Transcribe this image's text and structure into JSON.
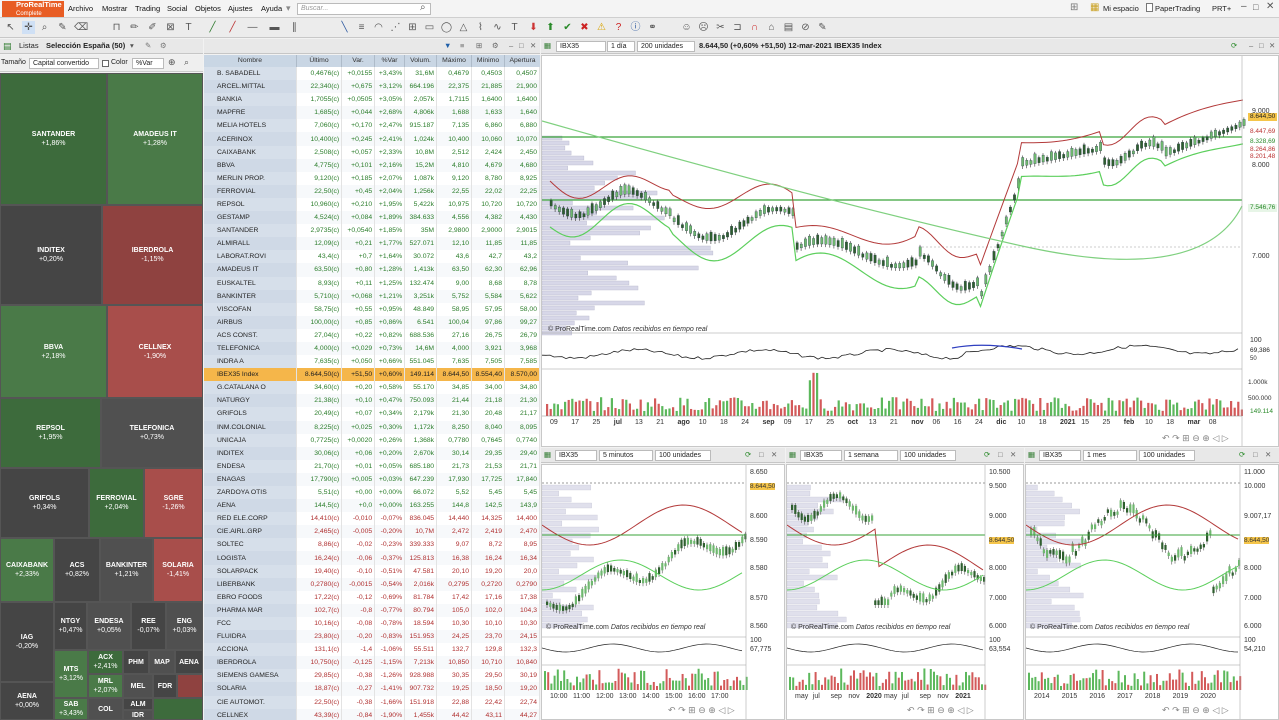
{
  "app": {
    "logo_line1": "ProRealTime",
    "logo_line2": "Complete"
  },
  "menu": [
    "Archivo",
    "Mostrar",
    "Trading",
    "Social",
    "Objetos",
    "Ajustes",
    "Ayuda"
  ],
  "search_placeholder": "Buscar...",
  "topright": {
    "space": "Mi espacio",
    "paper": "PaperTrading",
    "prt": "PRT+"
  },
  "lists": {
    "label": "Listas",
    "selection": "Selección España (50)",
    "size_label": "Tamaño",
    "size_value": "Capital convertido",
    "color_label": "Color",
    "color_value": "%Var"
  },
  "heatmap": [
    {
      "name": "SANTANDER",
      "pct": "+1,86%"
    },
    {
      "name": "AMADEUS IT",
      "pct": "+1,28%"
    },
    {
      "name": "INDITEX",
      "pct": "+0,20%"
    },
    {
      "name": "IBERDROLA",
      "pct": "-1,15%"
    },
    {
      "name": "BBVA",
      "pct": "+2,18%"
    },
    {
      "name": "CELLNEX",
      "pct": "-1,90%"
    },
    {
      "name": "REPSOL",
      "pct": "+1,95%"
    },
    {
      "name": "TELEFONICA",
      "pct": "+0,73%"
    },
    {
      "name": "GRIFOLS",
      "pct": "+0,34%"
    },
    {
      "name": "FERROVIAL",
      "pct": "+2,04%"
    },
    {
      "name": "SGRE",
      "pct": "-1,26%"
    },
    {
      "name": "CAIXABANK",
      "pct": "+2,33%"
    },
    {
      "name": "ACS",
      "pct": "+0,82%"
    },
    {
      "name": "BANKINTER",
      "pct": "+1,21%"
    },
    {
      "name": "SOLARIA",
      "pct": "-1,41%"
    },
    {
      "name": "NTGY",
      "pct": "+0,47%"
    },
    {
      "name": "ENDESA",
      "pct": "+0,05%"
    },
    {
      "name": "REE",
      "pct": "-0,07%"
    },
    {
      "name": "ENG",
      "pct": "+0,03%"
    },
    {
      "name": "IAG",
      "pct": "-0,20%"
    },
    {
      "name": "MTS",
      "pct": "+3,12%"
    },
    {
      "name": "ACX",
      "pct": "+2,41%"
    },
    {
      "name": "PHM",
      "pct": ""
    },
    {
      "name": "MAP",
      "pct": ""
    },
    {
      "name": "AENA",
      "pct": ""
    },
    {
      "name": "MRL",
      "pct": "+2,07%"
    },
    {
      "name": "MEL",
      "pct": ""
    },
    {
      "name": "FDR",
      "pct": ""
    },
    {
      "name": "AENA",
      "pct": "+0,00%"
    },
    {
      "name": "SAB",
      "pct": "+3,43%"
    },
    {
      "name": "COL",
      "pct": ""
    },
    {
      "name": "ALM",
      "pct": ""
    },
    {
      "name": "IDR",
      "pct": ""
    }
  ],
  "watchlist": {
    "columns": [
      "Nombre",
      "Último",
      "Var.",
      "%Var",
      "Volum.",
      "Máximo",
      "Mínimo",
      "Apertura"
    ],
    "rows": [
      [
        "B. SABADELL",
        "0,4676(c)",
        "+0,0155",
        "+3,43%",
        "31,6M",
        "0,4679",
        "0,4503",
        "0,4507"
      ],
      [
        "ARCEL.MITTAL",
        "22,340(c)",
        "+0,675",
        "+3,12%",
        "664.196",
        "22,375",
        "21,885",
        "21,900"
      ],
      [
        "BANKIA",
        "1,7055(c)",
        "+0,0505",
        "+3,05%",
        "2,057k",
        "1,7115",
        "1,6400",
        "1,6400"
      ],
      [
        "MAPFRE",
        "1,685(c)",
        "+0,044",
        "+2,68%",
        "4,806k",
        "1,688",
        "1,633",
        "1,640"
      ],
      [
        "MELIA HOTELS",
        "7,060(c)",
        "+0,170",
        "+2,47%",
        "915.187",
        "7,135",
        "6,860",
        "6,880"
      ],
      [
        "ACERINOX",
        "10,400(c)",
        "+0,245",
        "+2,41%",
        "1,024k",
        "10,400",
        "10,060",
        "10,070"
      ],
      [
        "CAIXABANK",
        "2,508(c)",
        "+0,057",
        "+2,33%",
        "10,8M",
        "2,512",
        "2,424",
        "2,450"
      ],
      [
        "BBVA",
        "4,775(c)",
        "+0,101",
        "+2,16%",
        "15,2M",
        "4,810",
        "4,679",
        "4,680"
      ],
      [
        "MERLIN PROP.",
        "9,120(c)",
        "+0,185",
        "+2,07%",
        "1,087k",
        "9,120",
        "8,780",
        "8,925"
      ],
      [
        "FERROVIAL",
        "22,50(c)",
        "+0,45",
        "+2,04%",
        "1,256k",
        "22,55",
        "22,02",
        "22,25"
      ],
      [
        "REPSOL",
        "10,960(c)",
        "+0,210",
        "+1,95%",
        "5,422k",
        "10,975",
        "10,720",
        "10,720"
      ],
      [
        "GESTAMP",
        "4,524(c)",
        "+0,084",
        "+1,89%",
        "384.633",
        "4,556",
        "4,382",
        "4,430"
      ],
      [
        "SANTANDER",
        "2,9735(c)",
        "+0,0540",
        "+1,85%",
        "35M",
        "2,9800",
        "2,9000",
        "2,9015"
      ],
      [
        "ALMIRALL",
        "12,09(c)",
        "+0,21",
        "+1,77%",
        "527.071",
        "12,10",
        "11,85",
        "11,85"
      ],
      [
        "LABORAT.ROVI",
        "43,4(c)",
        "+0,7",
        "+1,64%",
        "30.072",
        "43,6",
        "42,7",
        "43,2"
      ],
      [
        "AMADEUS IT",
        "63,50(c)",
        "+0,80",
        "+1,28%",
        "1,413k",
        "63,50",
        "62,30",
        "62,96"
      ],
      [
        "EUSKALTEL",
        "8,93(c)",
        "+0,11",
        "+1,25%",
        "132.474",
        "9,00",
        "8,68",
        "8,78"
      ],
      [
        "BANKINTER",
        "5,710(c)",
        "+0,068",
        "+1,21%",
        "3,251k",
        "5,752",
        "5,584",
        "5,622"
      ],
      [
        "VISCOFAN",
        "58,75(c)",
        "+0,55",
        "+0,95%",
        "48.849",
        "58,95",
        "57,95",
        "58,00"
      ],
      [
        "AIRBUS",
        "100,00(c)",
        "+0,85",
        "+0,86%",
        "6.541",
        "100,04",
        "97,86",
        "99,27"
      ],
      [
        "ACS CONST.",
        "27,04(c)",
        "+0,22",
        "+0,82%",
        "688.536",
        "27,16",
        "26,75",
        "26,79"
      ],
      [
        "TELEFONICA",
        "4,000(c)",
        "+0,029",
        "+0,73%",
        "14,6M",
        "4,000",
        "3,921",
        "3,968"
      ],
      [
        "INDRA A",
        "7,635(c)",
        "+0,050",
        "+0,66%",
        "551.045",
        "7,635",
        "7,505",
        "7,585"
      ],
      [
        "IBEX35 Index",
        "8.644,50(c)",
        "+51,50",
        "+0,60%",
        "149.114",
        "8.644,50",
        "8.554,40",
        "8.570,00"
      ],
      [
        "G.CATALANA O",
        "34,60(c)",
        "+0,20",
        "+0,58%",
        "55.170",
        "34,85",
        "34,00",
        "34,80"
      ],
      [
        "NATURGY",
        "21,38(c)",
        "+0,10",
        "+0,47%",
        "750.093",
        "21,44",
        "21,18",
        "21,30"
      ],
      [
        "GRIFOLS",
        "20,49(c)",
        "+0,07",
        "+0,34%",
        "2,179k",
        "21,30",
        "20,48",
        "21,17"
      ],
      [
        "INM.COLONIAL",
        "8,225(c)",
        "+0,025",
        "+0,30%",
        "1,172k",
        "8,250",
        "8,040",
        "8,095"
      ],
      [
        "UNICAJA",
        "0,7725(c)",
        "+0,0020",
        "+0,26%",
        "1,368k",
        "0,7780",
        "0,7645",
        "0,7740"
      ],
      [
        "INDITEX",
        "30,06(c)",
        "+0,06",
        "+0,20%",
        "2,670k",
        "30,14",
        "29,35",
        "29,40"
      ],
      [
        "ENDESA",
        "21,70(c)",
        "+0,01",
        "+0,05%",
        "685.180",
        "21,73",
        "21,53",
        "21,71"
      ],
      [
        "ENAGAS",
        "17,790(c)",
        "+0,005",
        "+0,03%",
        "647.239",
        "17,930",
        "17,725",
        "17,840"
      ],
      [
        "ZARDOYA OTIS",
        "5,51(c)",
        "+0,00",
        "+0,00%",
        "66.072",
        "5,52",
        "5,45",
        "5,45"
      ],
      [
        "AENA",
        "144,5(c)",
        "+0,0",
        "+0,00%",
        "163.255",
        "144,8",
        "142,5",
        "143,9"
      ],
      [
        "RED ELE.CORP",
        "14,410(c)",
        "-0,010",
        "-0,07%",
        "836.045",
        "14,440",
        "14,325",
        "14,400"
      ],
      [
        "CIE.AIRL.GRP",
        "2,465(c)",
        "-0,005",
        "-0,20%",
        "10,7M",
        "2,472",
        "2,419",
        "2,470"
      ],
      [
        "SOLTEC",
        "8,86(c)",
        "-0,02",
        "-0,23%",
        "339.333",
        "9,07",
        "8,72",
        "8,95"
      ],
      [
        "LOGISTA",
        "16,24(c)",
        "-0,06",
        "-0,37%",
        "125.813",
        "16,38",
        "16,24",
        "16,34"
      ],
      [
        "SOLARPACK",
        "19,40(c)",
        "-0,10",
        "-0,51%",
        "47.581",
        "20,10",
        "19,20",
        "20,0"
      ],
      [
        "LIBERBANK",
        "0,2780(c)",
        "-0,0015",
        "-0,54%",
        "2,016k",
        "0,2795",
        "0,2720",
        "0,2790"
      ],
      [
        "EBRO FOODS",
        "17,22(c)",
        "-0,12",
        "-0,69%",
        "81.784",
        "17,42",
        "17,16",
        "17,38"
      ],
      [
        "PHARMA MAR",
        "102,7(c)",
        "-0,8",
        "-0,77%",
        "80.794",
        "105,0",
        "102,0",
        "104,3"
      ],
      [
        "FCC",
        "10,16(c)",
        "-0,08",
        "-0,78%",
        "18.594",
        "10,30",
        "10,10",
        "10,30"
      ],
      [
        "FLUIDRA",
        "23,80(c)",
        "-0,20",
        "-0,83%",
        "151.953",
        "24,25",
        "23,70",
        "24,15"
      ],
      [
        "ACCIONA",
        "131,1(c)",
        "-1,4",
        "-1,06%",
        "55.511",
        "132,7",
        "129,8",
        "132,3"
      ],
      [
        "IBERDROLA",
        "10,750(c)",
        "-0,125",
        "-1,15%",
        "7,213k",
        "10,850",
        "10,710",
        "10,840"
      ],
      [
        "SIEMENS GAMESA",
        "29,85(c)",
        "-0,38",
        "-1,26%",
        "928.988",
        "30,35",
        "29,50",
        "30,19"
      ],
      [
        "SOLARIA",
        "18,87(c)",
        "-0,27",
        "-1,41%",
        "907.732",
        "19,25",
        "18,50",
        "19,20"
      ],
      [
        "CIE AUTOMOT.",
        "22,50(c)",
        "-0,38",
        "-1,66%",
        "151.918",
        "22,88",
        "22,42",
        "22,74"
      ],
      [
        "CELLNEX",
        "43,39(c)",
        "-0,84",
        "-1,90%",
        "1,455k",
        "44,42",
        "43,11",
        "44,27"
      ]
    ]
  },
  "main_chart": {
    "symbol": "IBX35",
    "interval": "1 día",
    "units": "200 unidades",
    "info": "8.644,50 (+0,60% +51,50) 12-mar-2021 IBEX35 Index",
    "watermark": "© ProRealTime.com",
    "watermark2": "Datos recibidos en tiempo real",
    "price_axis": [
      "9.000",
      "8.000",
      "7.000"
    ],
    "price_tags": [
      "8.644,50",
      "8.447,69",
      "8.328,69",
      "8.264,86",
      "8.201,48",
      "7.546,76"
    ],
    "osc_tags": [
      "100",
      "69,386",
      "50"
    ],
    "vol_tags": [
      "1.000k",
      "500.000",
      "149.114"
    ],
    "time_axis": [
      "09",
      "17",
      "25",
      "jul",
      "13",
      "21",
      "ago",
      "10",
      "18",
      "24",
      "sep",
      "09",
      "17",
      "25",
      "oct",
      "13",
      "21",
      "nov",
      "06",
      "16",
      "24",
      "dic",
      "10",
      "18",
      "2021",
      "15",
      "25",
      "feb",
      "10",
      "18",
      "mar",
      "08"
    ]
  },
  "sub_charts": [
    {
      "symbol": "IBX35",
      "interval": "5 minutos",
      "units": "100 unidades",
      "price_axis": [
        "8.650",
        "8.644,50",
        "8.600",
        "8.590",
        "8.580",
        "8.570",
        "8.560"
      ],
      "osc": [
        "100",
        "67,775"
      ],
      "time_axis": [
        "10:00",
        "11:00",
        "12:00",
        "13:00",
        "14:00",
        "15:00",
        "16:00",
        "17:00"
      ]
    },
    {
      "symbol": "IBX35",
      "interval": "1 semana",
      "units": "100 unidades",
      "price_axis": [
        "10.500",
        "9.500",
        "9.000",
        "8.644,50",
        "8.000",
        "7.000",
        "6.000"
      ],
      "osc": [
        "100",
        "63,554"
      ],
      "time_axis": [
        "may",
        "jul",
        "sep",
        "nov",
        "2020",
        "may",
        "jul",
        "sep",
        "nov",
        "2021"
      ]
    },
    {
      "symbol": "IBX35",
      "interval": "1 mes",
      "units": "100 unidades",
      "price_axis": [
        "11.000",
        "10.000",
        "9.007,17",
        "8.644,50",
        "8.000",
        "7.000",
        "6.000"
      ],
      "osc": [
        "100",
        "54,210"
      ],
      "time_axis": [
        "2014",
        "2015",
        "2016",
        "2017",
        "2018",
        "2019",
        "2020"
      ]
    }
  ],
  "colors": {
    "up": "#2a7d2a",
    "down": "#b03030",
    "highlight": "#f5b64a",
    "accent": "#e85d24"
  }
}
